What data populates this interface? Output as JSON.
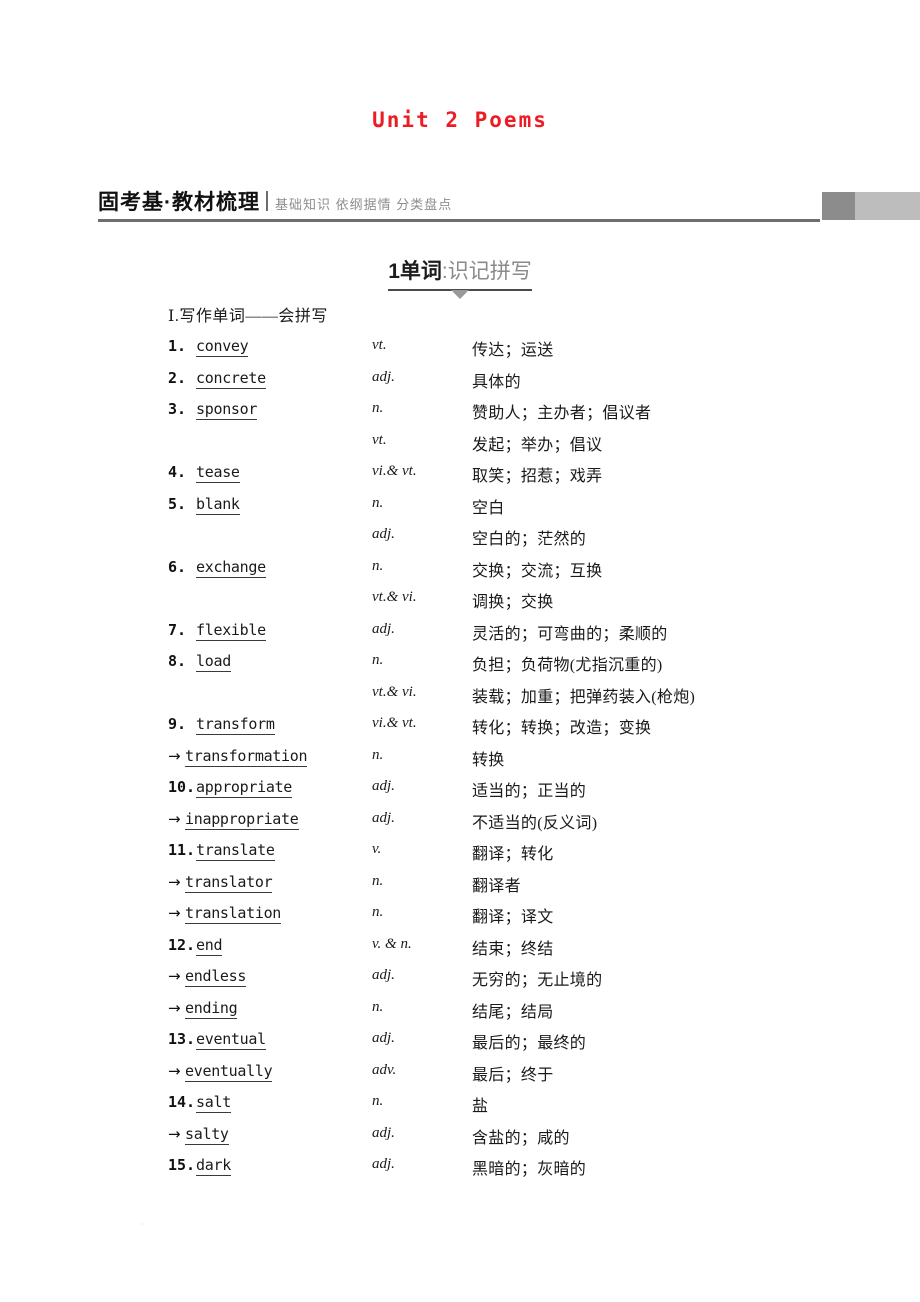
{
  "unit": {
    "title": "Unit 2 Poems",
    "title_color": "#ec1c24"
  },
  "header": {
    "title": "固考基·教材梳理",
    "subtitle": "基础知识 依纲据情 分类盘点",
    "rule_color": "#6e6e6e",
    "block_dark": "#8c8c8c",
    "block_light": "#bdbdbd"
  },
  "section": {
    "number": "1",
    "strong_label": "单词",
    "light_label": ":识记拼写",
    "caret_color": "#9a9a9a"
  },
  "part": {
    "label": "Ⅰ.写作单词——会拼写"
  },
  "words": [
    {
      "num": "1.",
      "kind": "numbered",
      "word": "convey",
      "pos": "vt.",
      "meaning": "传达；运送"
    },
    {
      "num": "2.",
      "kind": "numbered",
      "word": "concrete",
      "pos": "adj.",
      "meaning": "具体的"
    },
    {
      "num": "3.",
      "kind": "numbered",
      "word": "sponsor",
      "pos": "n.",
      "meaning": "赞助人；主办者；倡议者"
    },
    {
      "num": "",
      "kind": "cont",
      "word": "",
      "pos": "vt.",
      "meaning": "发起；举办；倡议"
    },
    {
      "num": "4.",
      "kind": "numbered",
      "word": "tease",
      "pos": "vi.& vt.",
      "meaning": "取笑；招惹；戏弄"
    },
    {
      "num": "5.",
      "kind": "numbered",
      "word": "blank",
      "pos": "n.",
      "meaning": "空白"
    },
    {
      "num": "",
      "kind": "cont",
      "word": "",
      "pos": "adj.",
      "meaning": "空白的；茫然的"
    },
    {
      "num": "6.",
      "kind": "numbered",
      "word": "exchange",
      "pos": "n.",
      "meaning": "交换；交流；互换"
    },
    {
      "num": "",
      "kind": "cont",
      "word": "",
      "pos": "vt.& vi.",
      "meaning": "调换；交换"
    },
    {
      "num": "7.",
      "kind": "numbered",
      "word": "flexible",
      "pos": "adj.",
      "meaning": "灵活的；可弯曲的；柔顺的"
    },
    {
      "num": "8.",
      "kind": "numbered",
      "word": "load",
      "pos": "n.",
      "meaning": "负担；负荷物(尤指沉重的)"
    },
    {
      "num": "",
      "kind": "cont",
      "word": "",
      "pos": "vt.& vi.",
      "meaning": "装载；加重；把弹药装入(枪炮)"
    },
    {
      "num": "9.",
      "kind": "numbered",
      "word": "transform",
      "pos": "vi.& vt.",
      "meaning": "转化；转换；改造；变换"
    },
    {
      "num": "→",
      "kind": "derived",
      "word": "transformation",
      "pos": "n.",
      "meaning": "转换"
    },
    {
      "num": "10.",
      "kind": "numbered",
      "word": "appropriate",
      "pos": "adj.",
      "meaning": "适当的；正当的"
    },
    {
      "num": "→",
      "kind": "derived",
      "word": "inappropriate",
      "pos": "adj.",
      "meaning": "不适当的(反义词)"
    },
    {
      "num": "11.",
      "kind": "numbered",
      "word": "translate",
      "pos": "v.",
      "meaning": "翻译；转化"
    },
    {
      "num": "→",
      "kind": "derived",
      "word": "translator",
      "pos": "n.",
      "meaning": "翻译者"
    },
    {
      "num": "→",
      "kind": "derived",
      "word": "translation",
      "pos": "n.",
      "meaning": "翻译；译文"
    },
    {
      "num": "12.",
      "kind": "numbered",
      "word": "end",
      "pos": "v. & n.",
      "meaning": "结束；终结"
    },
    {
      "num": "→",
      "kind": "derived",
      "word": "endless",
      "pos": "adj.",
      "meaning": "无穷的；无止境的"
    },
    {
      "num": "→",
      "kind": "derived",
      "word": "ending",
      "pos": "n.",
      "meaning": "结尾；结局"
    },
    {
      "num": "13.",
      "kind": "numbered",
      "word": "eventual",
      "pos": "adj.",
      "meaning": "最后的；最终的"
    },
    {
      "num": "→",
      "kind": "derived",
      "word": "eventually",
      "pos": "adv.",
      "meaning": "最后；终于"
    },
    {
      "num": "14.",
      "kind": "numbered",
      "word": "salt",
      "pos": "n.",
      "meaning": "盐"
    },
    {
      "num": "→",
      "kind": "derived",
      "word": "salty",
      "pos": "adj.",
      "meaning": "含盐的；咸的"
    },
    {
      "num": "15.",
      "kind": "numbered",
      "word": "dark",
      "pos": "adj.",
      "meaning": "黑暗的；灰暗的"
    }
  ]
}
